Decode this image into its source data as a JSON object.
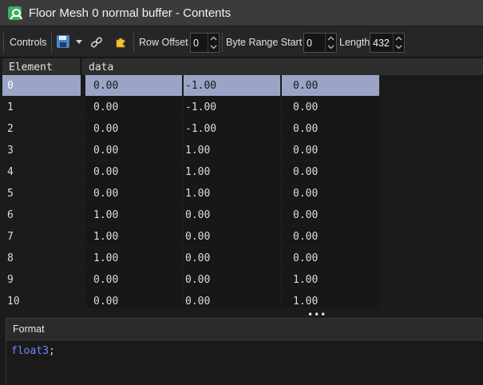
{
  "window": {
    "title": "Floor Mesh 0 normal buffer - Contents"
  },
  "toolbar": {
    "controls_label": "Controls",
    "save_icon": "floppy-save-icon",
    "link_icon": "link-icon",
    "puzzle_icon": "puzzle-icon",
    "row_offset_label": "Row Offset",
    "row_offset_value": "0",
    "byte_range_start_label": "Byte Range Start",
    "byte_range_start_value": "0",
    "length_label": "Length",
    "length_value": "432"
  },
  "table": {
    "columns": [
      "Element",
      "data"
    ],
    "selected_row": 0,
    "rows": [
      {
        "element": "0",
        "x": "0.00",
        "y": "-1.00",
        "z": "0.00"
      },
      {
        "element": "1",
        "x": "0.00",
        "y": "-1.00",
        "z": "0.00"
      },
      {
        "element": "2",
        "x": "0.00",
        "y": "-1.00",
        "z": "0.00"
      },
      {
        "element": "3",
        "x": "0.00",
        "y": "1.00",
        "z": "0.00"
      },
      {
        "element": "4",
        "x": "0.00",
        "y": "1.00",
        "z": "0.00"
      },
      {
        "element": "5",
        "x": "0.00",
        "y": "1.00",
        "z": "0.00"
      },
      {
        "element": "6",
        "x": "1.00",
        "y": "0.00",
        "z": "0.00"
      },
      {
        "element": "7",
        "x": "1.00",
        "y": "0.00",
        "z": "0.00"
      },
      {
        "element": "8",
        "x": "1.00",
        "y": "0.00",
        "z": "0.00"
      },
      {
        "element": "9",
        "x": "0.00",
        "y": "0.00",
        "z": "1.00"
      },
      {
        "element": "10",
        "x": "0.00",
        "y": "0.00",
        "z": "1.00"
      }
    ]
  },
  "splitter": {
    "handle": "•••"
  },
  "format": {
    "title": "Format",
    "code_type": "float3",
    "code_punct": ";"
  },
  "colors": {
    "selection": "#9aa5c6",
    "accent_icon": "#3fae5e",
    "keyword": "#6e8bff"
  }
}
